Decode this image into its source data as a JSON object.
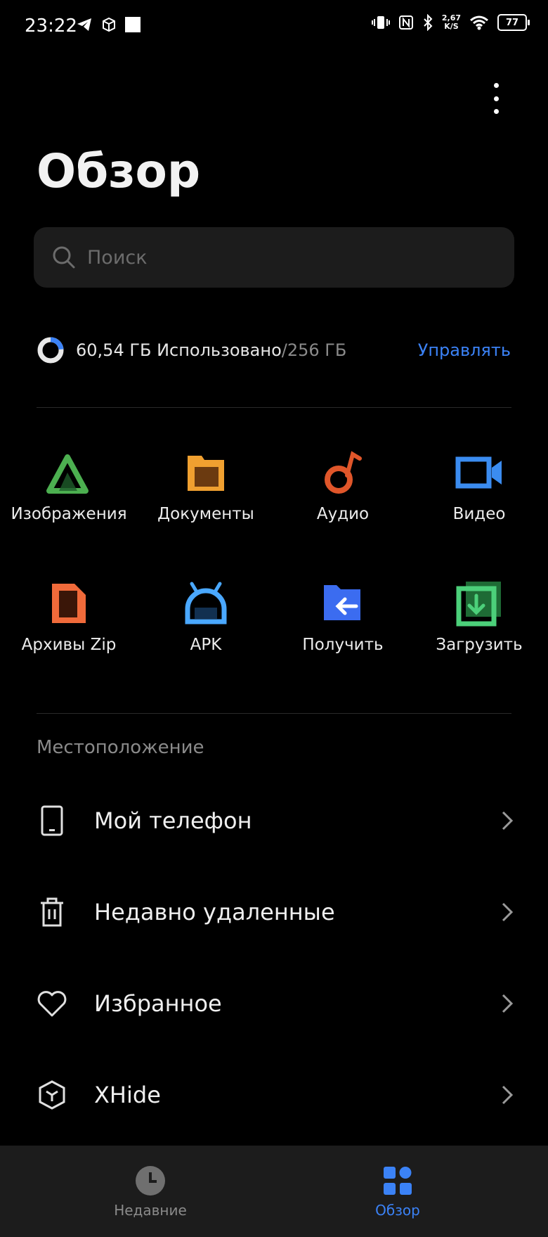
{
  "status_bar": {
    "time": "23:22",
    "speed_value": "2,67",
    "speed_unit": "K/S",
    "battery": "77"
  },
  "header": {
    "title": "Обзор",
    "more_icon": "more-vert-icon"
  },
  "search": {
    "placeholder": "Поиск"
  },
  "storage": {
    "used": "60,54 ГБ Использовано",
    "total": "/256 ГБ",
    "manage_label": "Управлять",
    "used_fraction": 0.236
  },
  "categories": [
    {
      "label": "Изображения",
      "icon": "images-icon"
    },
    {
      "label": "Документы",
      "icon": "documents-icon"
    },
    {
      "label": "Аудио",
      "icon": "audio-icon"
    },
    {
      "label": "Видео",
      "icon": "video-icon"
    },
    {
      "label": "Архивы Zip",
      "icon": "zip-icon"
    },
    {
      "label": "APK",
      "icon": "apk-icon"
    },
    {
      "label": "Получить",
      "icon": "receive-icon"
    },
    {
      "label": "Загрузить",
      "icon": "download-icon"
    }
  ],
  "location": {
    "section_title": "Местоположение",
    "items": [
      {
        "label": "Мой телефон",
        "icon": "phone-icon"
      },
      {
        "label": "Недавно удаленные",
        "icon": "trash-icon"
      },
      {
        "label": "Избранное",
        "icon": "heart-icon"
      },
      {
        "label": "XHide",
        "icon": "hexagon-icon"
      }
    ]
  },
  "bottom_nav": {
    "recent_label": "Недавние",
    "browse_label": "Обзор"
  },
  "colors": {
    "accent": "#3b82f6",
    "background": "#000000",
    "surface": "#1c1c1c"
  }
}
